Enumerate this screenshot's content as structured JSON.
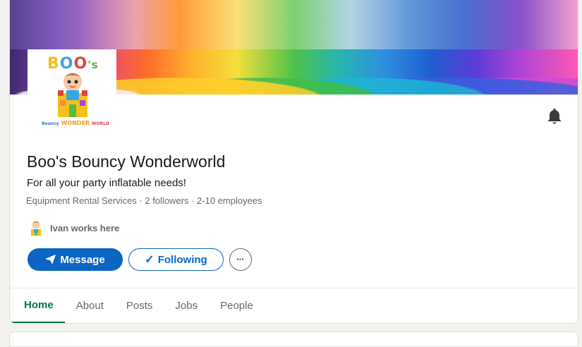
{
  "company": {
    "name": "Boo's Bouncy Wonderworld",
    "tagline": "For all your party inflatable needs!",
    "meta": "Equipment Rental Services · 2 followers · 2-10 employees",
    "works_here": "Ivan works here"
  },
  "logo": {
    "title_parts": [
      "B",
      "O",
      "O",
      "'s"
    ],
    "subtitle_parts": [
      "Bouncy",
      "WONDER",
      "WORLD"
    ]
  },
  "actions": {
    "message_label": "Message",
    "following_check": "✓",
    "following_label": "Following",
    "more_label": "•••"
  },
  "tabs": [
    {
      "label": "Home",
      "active": true
    },
    {
      "label": "About",
      "active": false
    },
    {
      "label": "Posts",
      "active": false
    },
    {
      "label": "Jobs",
      "active": false
    },
    {
      "label": "People",
      "active": false
    }
  ],
  "icons": {
    "notification": "bell-icon",
    "message": "send-icon",
    "following": "check-icon",
    "more": "ellipsis-icon"
  },
  "colors": {
    "primary": "#0a66c2",
    "active_tab": "#01754f"
  }
}
